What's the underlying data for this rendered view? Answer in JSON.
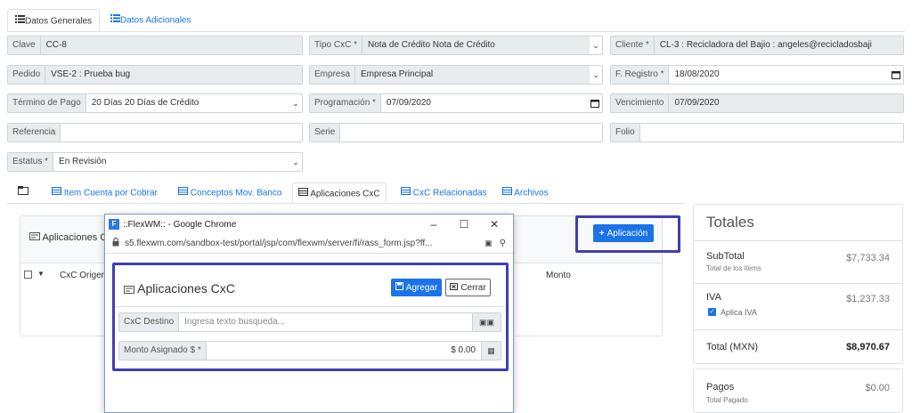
{
  "top_tabs": [
    {
      "label": "Datos Generales",
      "active": true
    },
    {
      "label": "Datos Adicionales",
      "active": false
    }
  ],
  "form": {
    "clave": {
      "label": "Clave",
      "value": "CC-8"
    },
    "tipo_cxc": {
      "label": "Tipo CxC *",
      "value": "Nota de Crédito Nota de Crédito"
    },
    "cliente": {
      "label": "Cliente *",
      "value": "CL-3 : Recicladora del Bajio : angeles@recicladosbaji"
    },
    "pedido": {
      "label": "Pedido",
      "value": "VSE-2 : Prueba bug"
    },
    "empresa": {
      "label": "Empresa",
      "value": "Empresa Principal"
    },
    "f_registro": {
      "label": "F. Registro *",
      "value": "18/08/2020"
    },
    "termino_pago": {
      "label": "Término de Pago",
      "value": "20 Días 20 Días de Crédito"
    },
    "programacion": {
      "label": "Programación *",
      "value": "07/09/2020"
    },
    "vencimiento": {
      "label": "Vencimiento",
      "value": "07/09/2020"
    },
    "referencia": {
      "label": "Referencia",
      "value": ""
    },
    "serie": {
      "label": "Serie",
      "value": ""
    },
    "folio": {
      "label": "Folio",
      "value": ""
    },
    "estatus": {
      "label": "Estatus *",
      "value": "En Revisión"
    }
  },
  "sub_tabs": [
    {
      "label": "Item Cuenta por Cobrar"
    },
    {
      "label": "Conceptos Mov. Banco"
    },
    {
      "label": "Aplicaciones CxC"
    },
    {
      "label": "CxC Relacionadas"
    },
    {
      "label": "Archivos"
    }
  ],
  "aplicaciones_panel": {
    "title": "Aplicaciones C",
    "col_origen": "CxC Origen",
    "col_monto": "Monto",
    "add_button": "Aplicación"
  },
  "totales": {
    "title": "Totales",
    "subtotal_label": "SubTotal",
    "subtotal_sub": "Total de los items",
    "subtotal_value": "$7,733.34",
    "iva_label": "IVA",
    "iva_value": "$1,237.33",
    "aplica_iva": "Aplica IVA",
    "total_label": "Total (MXN)",
    "total_value": "$8,970.67",
    "pagos_label": "Pagos",
    "pagos_sub": "Total Pagado",
    "pagos_value": "$0.00"
  },
  "popup": {
    "window_title": "::FlexWM:: - Google Chrome",
    "url": "s5.flexwm.com/sandbox-test/portal/jsp/com/flexwm/server/fi/rass_form.jsp?ff...",
    "form_title": "Aplicaciones CxC",
    "agregar": "Agregar",
    "cerrar": "Cerrar",
    "cxc_destino_label": "CxC Destino",
    "cxc_destino_placeholder": "Ingresa texto busqueda...",
    "monto_label": "Monto Asignado $ *",
    "monto_value": "$ 0.00"
  },
  "colors": {
    "accent": "#1a73e8",
    "highlight": "#3f3fb0"
  }
}
